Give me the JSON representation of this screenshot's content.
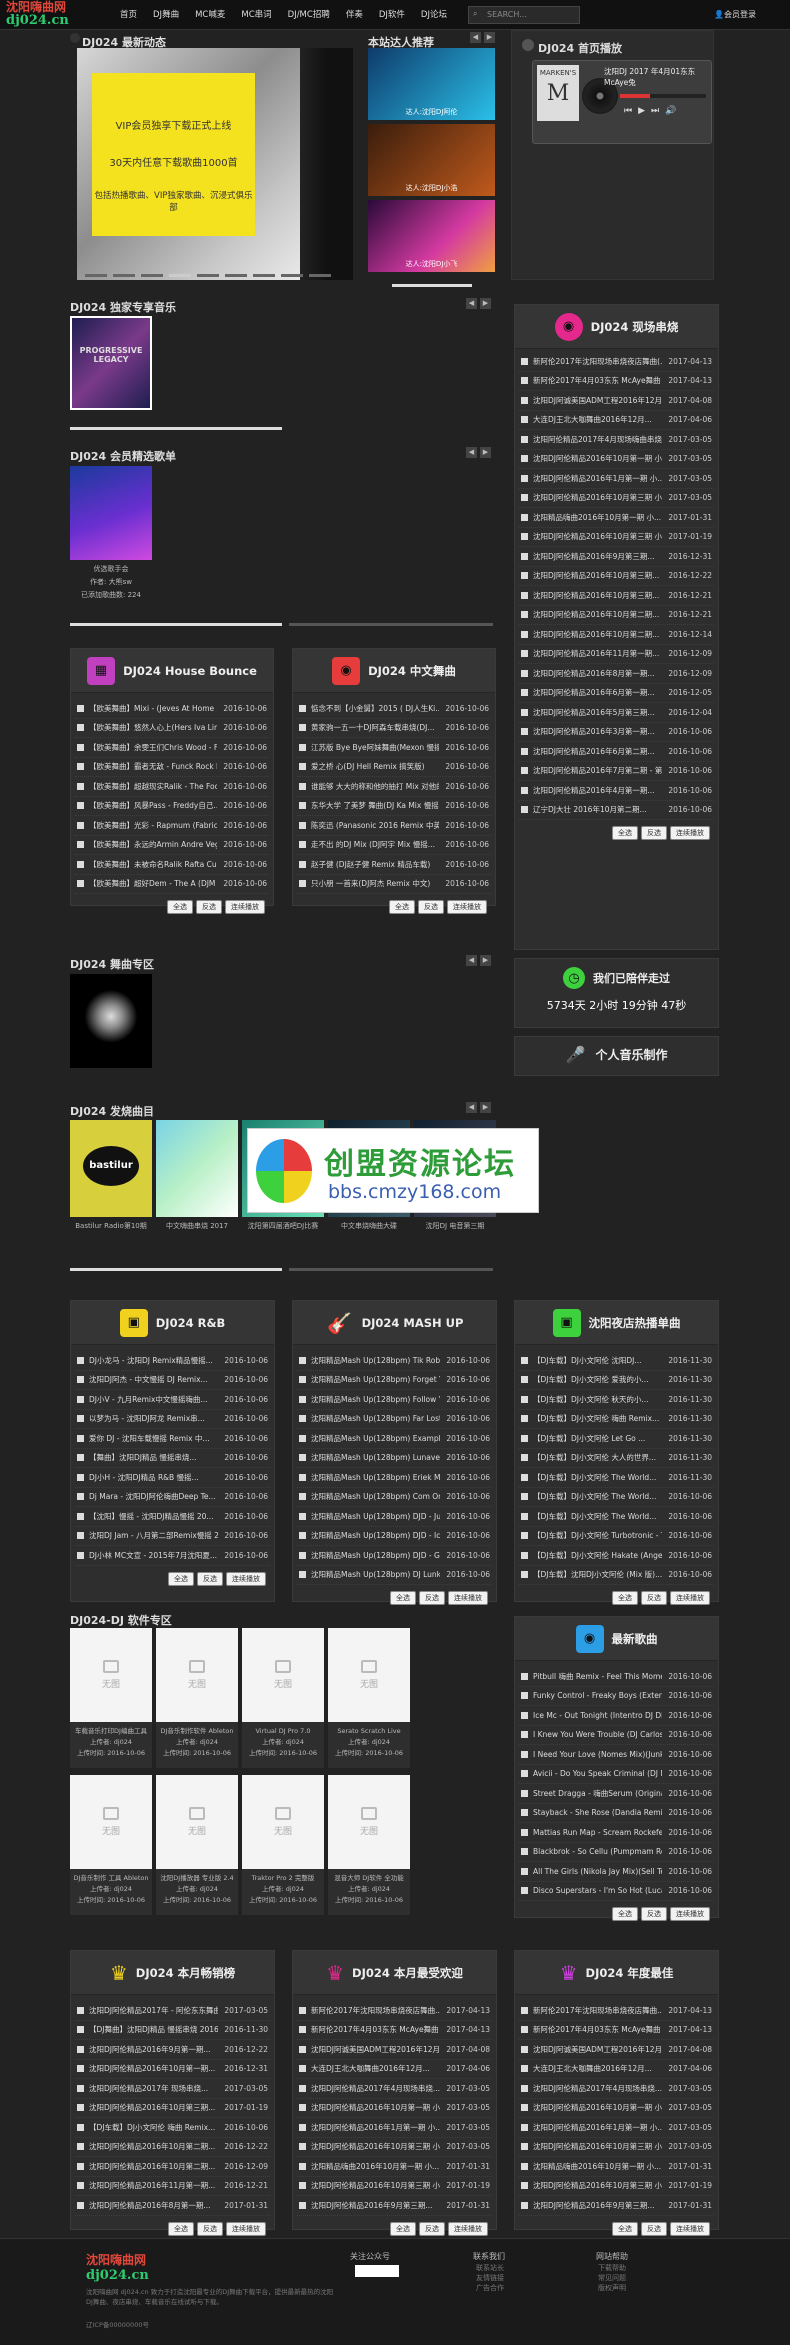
{
  "brand": {
    "line1": "沈阳嗨曲网",
    "line2": "dj024.cn"
  },
  "nav": [
    "首页",
    "DJ舞曲",
    "MC喊麦",
    "MC串词",
    "DJ/MC招聘",
    "伴奏",
    "DJ软件",
    "DJ论坛"
  ],
  "search": {
    "placeholder": "SEARCH..."
  },
  "login": "会员登录",
  "slider": {
    "title": "DJ024 最新动态",
    "box_lines": [
      "VIP会员独享下载正式上线",
      "30天内任意下载歌曲1000首",
      "包括热播歌曲、VIP独家歌曲、沉浸式俱乐部"
    ]
  },
  "recommend": {
    "title": "本站达人推荐",
    "items": [
      "达人:沈阳DJ阿伦",
      "达人:沈阳DJ小浩",
      "达人:沈阳DJ小飞"
    ]
  },
  "player": {
    "title": "DJ024 首页播放",
    "track": "沈阳DJ 2017 年4月01东东 McAye兔",
    "cover": "MARKEN'S"
  },
  "exclusive": {
    "title": "DJ024 独家专享音乐",
    "cover_text": "PROGRESSIVE LEGACY"
  },
  "member": {
    "title": "DJ024 会员精选歌单",
    "lines": [
      "优选歌手会",
      "作者: 大熊sw",
      "已添加歌曲数: 224"
    ]
  },
  "house": {
    "title": "DJ024 House Bounce",
    "rows": [
      [
        "【欧美舞曲】Mixi - (Jeves At Home 心DJ S...",
        "2016-10-06"
      ],
      [
        "【欧美舞曲】悠然人心上(Hers Iva Limitt2...",
        "2016-10-06"
      ],
      [
        "【欧美舞曲】余雯王们Chris Wood - F...",
        "2016-10-06"
      ],
      [
        "【欧美舞曲】霸者无敌 - Funck Rock B...",
        "2016-10-06"
      ],
      [
        "【欧美舞曲】超越现实Ralik - The Foo(DJ...",
        "2016-10-06"
      ],
      [
        "【欧美舞曲】风暴Pass - Freddy自己...",
        "2016-10-06"
      ],
      [
        "【欧美舞曲】光彩 - Rapmum (Fabricio...",
        "2016-10-06"
      ],
      [
        "【欧美舞曲】永远的Armin Andre Vegas - R...",
        "2016-10-06"
      ],
      [
        "【欧美舞曲】未被命名Ralik Rafta Cumt...",
        "2016-10-06"
      ],
      [
        "【欧美舞曲】超好Dem - The A (DJM Re...",
        "2016-10-06"
      ]
    ]
  },
  "chinese": {
    "title": "DJ024 中文舞曲",
    "rows": [
      [
        "惦念不到【小金舅】2015 ( DJ人生Ki...",
        "2016-10-06"
      ],
      [
        "黄家驹一五一十DJ阿森车载串烧(DJ...",
        "2016-10-06"
      ],
      [
        "江苏版 Bye Bye阿妹舞曲(Mexon 慢摇...",
        "2016-10-06"
      ],
      [
        "爱之桥 心(DJ Hell Remix 搞笑版)",
        "2016-10-06"
      ],
      [
        "谁能够 大大的称和他的抽打 Mix 对他的...",
        "2016-10-06"
      ],
      [
        "东华大学 了美梦 舞曲(DJ Ka Mix 慢摇...",
        "2016-10-06"
      ],
      [
        "陈奕迅 (Panasonic 2016 Remix 中英...",
        "2016-10-06"
      ],
      [
        "走不出 的DJ Mix (DJ阿宇 Mix 慢摇...",
        "2016-10-06"
      ],
      [
        "赵子健 (DJ赵子健 Remix 精品车载)",
        "2016-10-06"
      ],
      [
        "只小朋 一首来(DJ阿杰 Remix 中文)",
        "2016-10-06"
      ]
    ]
  },
  "buttons": {
    "all": "全选",
    "invert": "反选",
    "play": "连续播放"
  },
  "horror": {
    "title": "DJ024 舞曲专区"
  },
  "featured": {
    "title": "DJ024 发烧曲目",
    "captions": [
      "Bastilur Radio第10期",
      "中文嗨曲串烧 2017",
      "沈阳第四届酒吧DJ比赛",
      "中文串烧嗨曲大碟",
      "沈阳DJ 电音第三期"
    ]
  },
  "watermark": {
    "line1": "创盟资源论坛",
    "line2": "bbs.cmzy168.com"
  },
  "side": {
    "title": "DJ024 现场串烧",
    "rows": [
      [
        "新阿伦2017年沈阳现场串烧夜店舞曲(...",
        "2017-04-13"
      ],
      [
        "新阿伦2017年4月03东东 McAye舞曲",
        "2017-04-13"
      ],
      [
        "沈阳DJ阿诚美国ADM工程2016年12月...",
        "2017-04-08"
      ],
      [
        "大连DJ王北大咖舞曲2016年12月...",
        "2017-04-06"
      ],
      [
        "沈阳阿伦精品2017年4月现场嗨曲串烧",
        "2017-03-05"
      ],
      [
        "沈阳DJ阿伦精品2016年10月第一期 小...",
        "2017-03-05"
      ],
      [
        "沈阳DJ阿伦精品2016年1月第一期 小...",
        "2017-03-05"
      ],
      [
        "沈阳DJ阿伦精品2016年10月第三期 小...",
        "2017-03-05"
      ],
      [
        "沈阳精品嗨曲2016年10月第一期 小...",
        "2017-01-31"
      ],
      [
        "沈阳DJ阿伦精品2016年10月第三期 小...",
        "2017-01-19"
      ],
      [
        "沈阳DJ阿伦精品2016年9月第三期...",
        "2016-12-31"
      ],
      [
        "沈阳DJ阿伦精品2016年10月第三期...",
        "2016-12-22"
      ],
      [
        "沈阳DJ阿伦精品2016年10月第三期...",
        "2016-12-21"
      ],
      [
        "沈阳DJ阿伦精品2016年10月第二期...",
        "2016-12-21"
      ],
      [
        "沈阳DJ阿伦精品2016年10月第二期...",
        "2016-12-14"
      ],
      [
        "沈阳DJ阿伦精品2016年11月第一期...",
        "2016-12-09"
      ],
      [
        "沈阳DJ阿伦精品2016年8月第一期...",
        "2016-12-09"
      ],
      [
        "沈阳DJ阿伦精品2016年6月第一期...",
        "2016-12-05"
      ],
      [
        "沈阳DJ阿伦精品2016年5月第三期...",
        "2016-12-04"
      ],
      [
        "沈阳DJ阿伦精品2016年3月第一期...",
        "2016-10-06"
      ],
      [
        "沈阳DJ阿伦精品2016年6月第二期...",
        "2016-10-06"
      ],
      [
        "沈阳DJ阿伦精品2016年7月第二期 - 第二...",
        "2016-10-06"
      ],
      [
        "沈阳DJ阿伦精品2016年4月第一期...",
        "2016-10-06"
      ],
      [
        "辽宁DJ大壮 2016年10月第二期...",
        "2016-10-06"
      ]
    ]
  },
  "stats": {
    "title": "我们已陪伴走过",
    "text": "5734天 2小时 19分钟 47秒"
  },
  "music_make": {
    "title": "个人音乐制作"
  },
  "rnb": {
    "title": "DJ024 R&B",
    "rows": [
      [
        "DJ小龙马 - 沈阳DJ Remix精品慢摇...",
        "2016-10-06"
      ],
      [
        "沈阳DJ阿杰 - 中文慢摇 DJ Remix...",
        "2016-10-06"
      ],
      [
        "DJ小V - 九月Remix中文慢摇嗨曲...",
        "2016-10-06"
      ],
      [
        "以梦为马 - 沈阳DJ阿龙 Remix串...",
        "2016-10-06"
      ],
      [
        "爱你 DJ - 沈阳车载慢摇 Remix 中...",
        "2016-10-06"
      ],
      [
        "【舞曲】沈阳DJ精品 慢摇串烧...",
        "2016-10-06"
      ],
      [
        "DJ小H - 沈阳DJ精品 R&B 慢摇...",
        "2016-10-06"
      ],
      [
        "Dj Mara - 沈阳DJ阿伦嗨曲Deep Te...",
        "2016-10-06"
      ],
      [
        "【沈阳】慢摇 - 沈阳DJ精品慢摇 20...",
        "2016-10-06"
      ],
      [
        "沈阳DJ Jam - 八月第二部Remix慢摇 20...",
        "2016-10-06"
      ],
      [
        "DJ小林 MC文宣 - 2015年7月沈阳夏...",
        "2016-10-06"
      ]
    ]
  },
  "mashup": {
    "title": "DJ024 MASH UP",
    "rows": [
      [
        "沈阳精品Mash Up(128bpm) Tik Rob...",
        "2016-10-06"
      ],
      [
        "沈阳精品Mash Up(128bpm) Forget Yo...",
        "2016-10-06"
      ],
      [
        "沈阳精品Mash Up(128bpm) Follow Y...",
        "2016-10-06"
      ],
      [
        "沈阳精品Mash Up(128bpm) Far Lost M...",
        "2016-10-06"
      ],
      [
        "沈阳精品Mash Up(128bpm) Example ...",
        "2016-10-06"
      ],
      [
        "沈阳精品Mash Up(128bpm) Lunavere V...",
        "2016-10-06"
      ],
      [
        "沈阳精品Mash Up(128bpm) Eriek Mod...",
        "2016-10-06"
      ],
      [
        "沈阳精品Mash Up(128bpm) Com Oma...",
        "2016-10-06"
      ],
      [
        "沈阳精品Mash Up(128bpm) DJD - Jump",
        "2016-10-06"
      ],
      [
        "沈阳精品Mash Up(128bpm) DJD - Ice C...",
        "2016-10-06"
      ],
      [
        "沈阳精品Mash Up(128bpm) DJD - Giga...",
        "2016-10-06"
      ],
      [
        "沈阳精品Mash Up(128bpm) DJ Lunkal...",
        "2016-10-06"
      ]
    ]
  },
  "nightclub": {
    "title": "沈阳夜店热播单曲",
    "rows": [
      [
        "【DJ车载】DJ小文阿伦 沈阳DJ...",
        "2016-11-30"
      ],
      [
        "【DJ车载】DJ小文阿伦 爱我的小...",
        "2016-11-30"
      ],
      [
        "【DJ车载】DJ小文阿伦 秋天的小...",
        "2016-11-30"
      ],
      [
        "【DJ车载】DJ小文阿伦 嗨曲 Remix...",
        "2016-11-30"
      ],
      [
        "【DJ车载】DJ小文阿伦 Let Go ...",
        "2016-11-30"
      ],
      [
        "【DJ车载】DJ小文阿伦 大人的世界...",
        "2016-11-30"
      ],
      [
        "【DJ车载】DJ小文阿伦 The World...",
        "2016-11-30"
      ],
      [
        "【DJ车载】DJ小文阿伦 The World...",
        "2016-10-06"
      ],
      [
        "【DJ车载】DJ小文阿伦 The World...",
        "2016-10-06"
      ],
      [
        "【DJ车载】DJ小文阿伦 Turbotronic - To...",
        "2016-10-06"
      ],
      [
        "【DJ车载】DJ小文阿伦 Hakate (Angel...",
        "2016-10-06"
      ],
      [
        "【DJ车载】沈阳DJ小文阿伦 (Mix 版)...",
        "2016-10-06"
      ]
    ]
  },
  "software": {
    "title": "DJ024-DJ 软件专区",
    "noimg": "无图",
    "items": [
      [
        "车载音乐打印DJ编曲工具",
        "上传者: dj024",
        "上传时间: 2016-10-06"
      ],
      [
        "DJ音乐制作软件 Ableton",
        "上传者: dj024",
        "上传时间: 2016-10-06"
      ],
      [
        "Virtual DJ Pro 7.0",
        "上传者: dj024",
        "上传时间: 2016-10-06"
      ],
      [
        "Serato Scratch Live",
        "上传者: dj024",
        "上传时间: 2016-10-06"
      ],
      [
        "DJ音乐制作 工具 Ableton",
        "上传者: dj024",
        "上传时间: 2016-10-06"
      ],
      [
        "沈阳DJ播放器 专业版 2.4",
        "上传者: dj024",
        "上传时间: 2016-10-06"
      ],
      [
        "Traktor Pro 2 完整版",
        "上传者: dj024",
        "上传时间: 2016-10-06"
      ],
      [
        "混音大师 DJ软件 全功能",
        "上传者: dj024",
        "上传时间: 2016-10-06"
      ]
    ]
  },
  "newsongs": {
    "title": "最新歌曲",
    "rows": [
      [
        "Pitbull 嗨曲 Remix - Feel This Moment(DJ...",
        "2016-10-06"
      ],
      [
        "Funky Control - Freaky Boys (Extended...",
        "2016-10-06"
      ],
      [
        "Ice Mc - Out Tonight (Intentro DJ Dirty Mix)",
        "2016-10-06"
      ],
      [
        "I Knew You Were Trouble (DJ Carlos R...",
        "2016-10-06"
      ],
      [
        "I Need Your Love (Nomes Mix)(Junksk...",
        "2016-10-06"
      ],
      [
        "Avicii - Do You Speak Criminal (DJ Mi...",
        "2016-10-06"
      ],
      [
        "Street Dragga - 嗨曲Serum (Original Fun...",
        "2016-10-06"
      ],
      [
        "Stayback - She Rose (Dandia Remix)(D...",
        "2016-10-06"
      ],
      [
        "Mattias Run Map - Scream Rockefeller(D...",
        "2016-10-06"
      ],
      [
        "Blackbrok - So Cellu (Pumpmam Remix...",
        "2016-10-06"
      ],
      [
        "All The Girls (Nikola Jay Mix)(Sell Tech...",
        "2016-10-06"
      ],
      [
        "Disco Superstars - I'm So Hot (Lucas Fr...",
        "2016-10-06"
      ]
    ]
  },
  "monthly": {
    "title": "DJ024 本月畅销榜",
    "rows": [
      [
        "沈阳DJ阿伦精品2017年 - 阿伦东东舞曲...",
        "2017-03-05"
      ],
      [
        "【DJ舞曲】沈阳DJ精品 慢摇串烧 2016...",
        "2016-11-30"
      ],
      [
        "沈阳DJ阿伦精品2016年9月第一期...",
        "2016-12-22"
      ],
      [
        "沈阳DJ阿伦精品2016年10月第一期...",
        "2016-12-31"
      ],
      [
        "沈阳DJ阿伦精品2017年 现场串烧...",
        "2017-03-05"
      ],
      [
        "沈阳DJ阿伦精品2016年10月第三期...",
        "2017-01-19"
      ],
      [
        "【DJ车载】DJ小文阿伦 嗨曲 Remix...",
        "2016-10-06"
      ],
      [
        "沈阳DJ阿伦精品2016年10月第二期...",
        "2016-12-22"
      ],
      [
        "沈阳DJ阿伦精品2016年10月第二期...",
        "2016-12-09"
      ],
      [
        "沈阳DJ阿伦精品2016年11月第一期...",
        "2016-12-21"
      ],
      [
        "沈阳DJ阿伦精品2016年8月第一期...",
        "2017-01-31"
      ]
    ]
  },
  "popular": {
    "title": "DJ024 本月最受欢迎",
    "rows": [
      [
        "新阿伦2017年沈阳现场串烧夜店舞曲...",
        "2017-04-13"
      ],
      [
        "新阿伦2017年4月03东东 McAye舞曲",
        "2017-04-13"
      ],
      [
        "沈阳DJ阿诚美国ADM工程2016年12月...",
        "2017-04-08"
      ],
      [
        "大连DJ王北大咖舞曲2016年12月...",
        "2017-04-06"
      ],
      [
        "沈阳DJ阿伦精品2017年4月现场串烧...",
        "2017-03-05"
      ],
      [
        "沈阳DJ阿伦精品2016年10月第一期 小...",
        "2017-03-05"
      ],
      [
        "沈阳DJ阿伦精品2016年1月第一期 小...",
        "2017-03-05"
      ],
      [
        "沈阳DJ阿伦精品2016年10月第三期 小...",
        "2017-03-05"
      ],
      [
        "沈阳精品嗨曲2016年10月第一期 小...",
        "2017-01-31"
      ],
      [
        "沈阳DJ阿伦精品2016年10月第三期 小...",
        "2017-01-19"
      ],
      [
        "沈阳DJ阿伦精品2016年9月第三期...",
        "2017-01-31"
      ]
    ]
  },
  "yearly": {
    "title": "DJ024 年度最佳",
    "rows": [
      [
        "新阿伦2017年沈阳现场串烧夜店舞曲...",
        "2017-04-13"
      ],
      [
        "新阿伦2017年4月03东东 McAye舞曲",
        "2017-04-13"
      ],
      [
        "沈阳DJ阿诚美国ADM工程2016年12月...",
        "2017-04-08"
      ],
      [
        "大连DJ王北大咖舞曲2016年12月...",
        "2017-04-06"
      ],
      [
        "沈阳DJ阿伦精品2017年4月现场串烧...",
        "2017-03-05"
      ],
      [
        "沈阳DJ阿伦精品2016年10月第一期 小...",
        "2017-03-05"
      ],
      [
        "沈阳DJ阿伦精品2016年1月第一期 小...",
        "2017-03-05"
      ],
      [
        "沈阳DJ阿伦精品2016年10月第三期 小...",
        "2017-03-05"
      ],
      [
        "沈阳精品嗨曲2016年10月第一期 小...",
        "2017-01-31"
      ],
      [
        "沈阳DJ阿伦精品2016年10月第三期 小...",
        "2017-01-19"
      ],
      [
        "沈阳DJ阿伦精品2016年9月第三期...",
        "2017-01-31"
      ]
    ]
  },
  "footer": {
    "desc": "沈阳嗨曲网 dj024.cn 致力于打造沈阳最专业的DJ舞曲下载平台，提供最新最热的沈阳DJ舞曲、夜店串烧、车载音乐在线试听与下载。",
    "icp": "辽ICP备00000000号",
    "cols": [
      {
        "title": "关注公众号",
        "items": []
      },
      {
        "title": "联系我们",
        "items": [
          "联系站长",
          "友情链接",
          "广告合作"
        ]
      },
      {
        "title": "网站帮助",
        "items": [
          "下载帮助",
          "常见问题",
          "版权声明"
        ]
      }
    ]
  },
  "colors": {
    "pink": "#e4288c",
    "red": "#e63c3c",
    "yellow": "#f0d21e",
    "green": "#3ed13e",
    "blue": "#2c9ee6",
    "teal": "#1bbf9f"
  }
}
